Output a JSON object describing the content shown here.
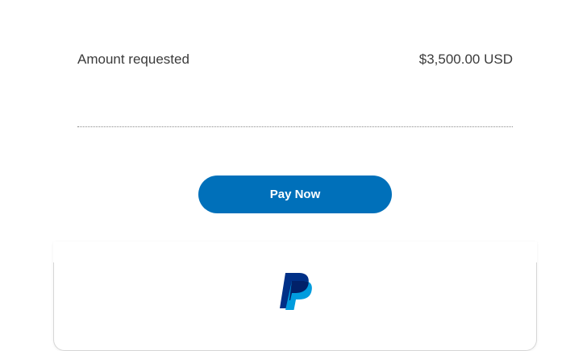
{
  "payment": {
    "amount_label": "Amount requested",
    "amount_value": "$3,500.00 USD"
  },
  "actions": {
    "pay_now_label": "Pay Now"
  },
  "footer": {
    "logo_icon": "paypal-icon",
    "colors": {
      "dark_blue": "#003087",
      "light_blue": "#009cde",
      "button_blue": "#0070ba"
    }
  }
}
